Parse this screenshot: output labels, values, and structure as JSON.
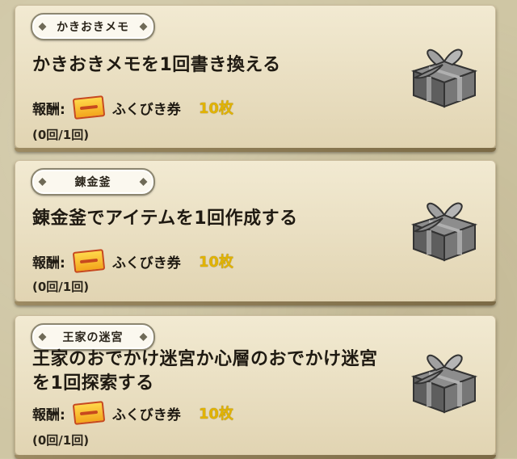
{
  "missions": [
    {
      "tag": "かきおきメモ",
      "text_lines": [
        "かきおきメモを1回書き換える"
      ],
      "reward_label": "報酬:",
      "reward_item": "ふくびき券",
      "reward_amount": "10枚",
      "progress": "(0回/1回)"
    },
    {
      "tag": "錬金釜",
      "text_lines": [
        "錬金釜でアイテムを1回作成する"
      ],
      "reward_label": "報酬:",
      "reward_item": "ふくびき券",
      "reward_amount": "10枚",
      "progress": "(0回/1回)"
    },
    {
      "tag": "王家の迷宮",
      "text_lines": [
        "王家のおでかけ迷宮か心層のおでかけ迷宮",
        "を1回探索する"
      ],
      "reward_label": "報酬:",
      "reward_item": "ふくびき券",
      "reward_amount": "10枚",
      "progress": "(0回/1回)"
    }
  ],
  "icons": {
    "reward": "ticket-icon",
    "gift": "gift-box-icon"
  },
  "colors": {
    "card": "#efe6cb",
    "amount": "#e1b300",
    "ticket": "#f3a51c"
  }
}
